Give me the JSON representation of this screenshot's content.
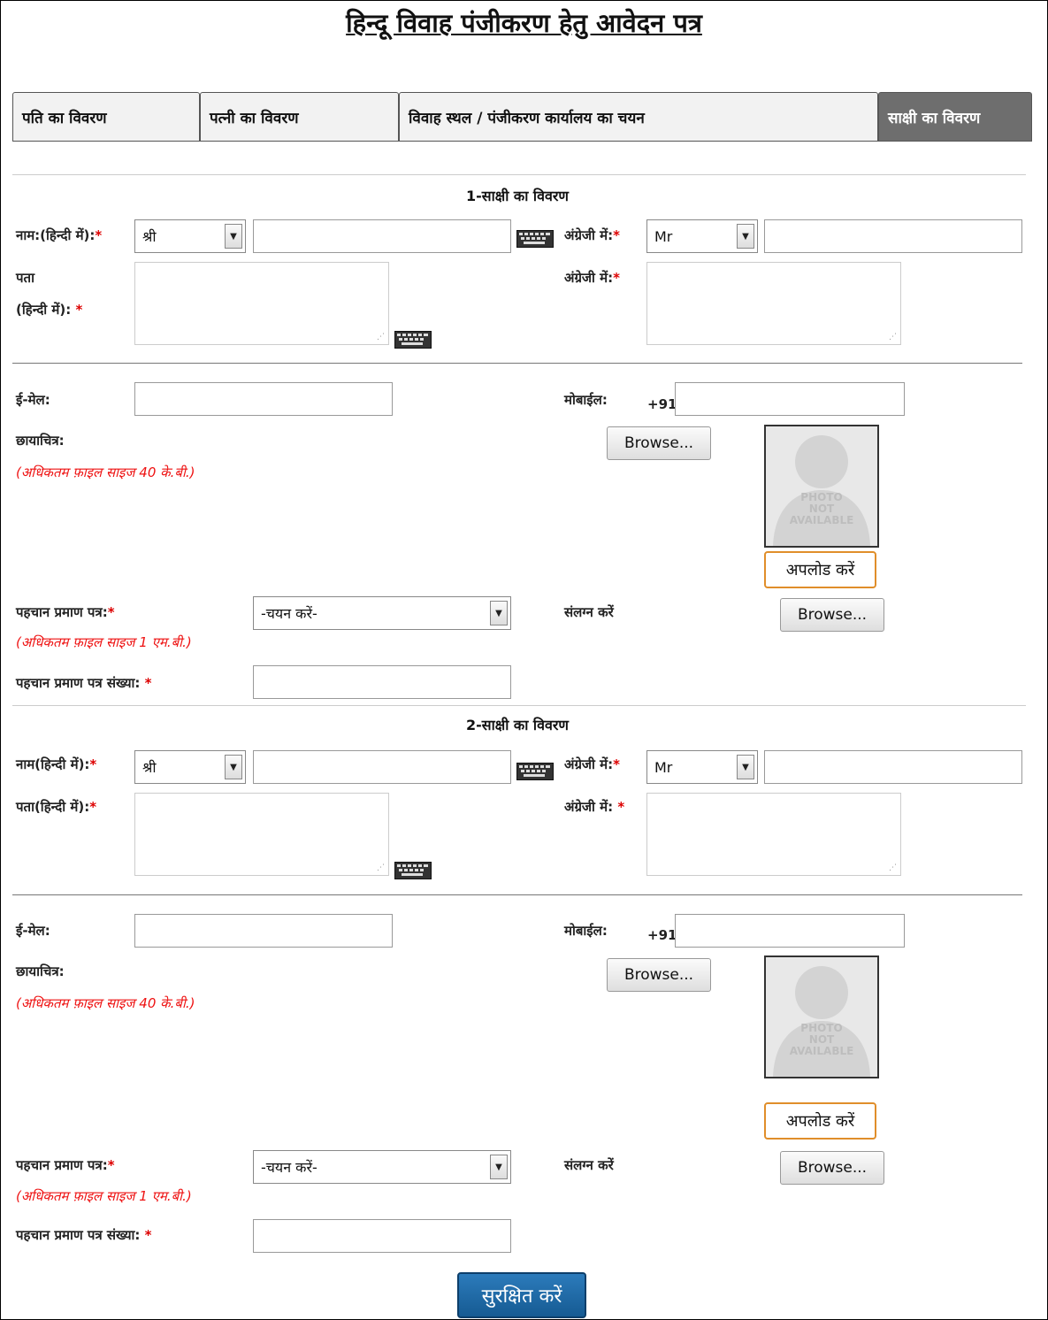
{
  "page": {
    "title": "हिन्दू विवाह पंजीकरण हेतु आवेदन पत्र"
  },
  "tabs": [
    {
      "label": "पति का विवरण",
      "active": false
    },
    {
      "label": "पत्नी का विवरण",
      "active": false
    },
    {
      "label": "विवाह स्थल / पंजीकरण कार्यालय का चयन",
      "active": false
    },
    {
      "label": "साक्षी का विवरण",
      "active": true
    }
  ],
  "witness1": {
    "heading": "1-साक्षी का विवरण",
    "name_label": "नाम:(हिन्दी में):",
    "salutation_hi": "श्री",
    "english_label": "अंग्रेजी में:",
    "salutation_en": "Mr",
    "address_label_line1": "पता",
    "address_label_line2": "(हिन्दी में):",
    "address_english_label": "अंग्रेजी में:",
    "email_label": "ई-मेल:",
    "mobile_label": "मोबाईल:",
    "mobile_prefix": "+91",
    "photo_label": "छायाचित्र:",
    "photo_note": "(अधिकतम फ़ाइल साइज 40 के.बी.)",
    "browse_label": "Browse...",
    "photo_placeholder": [
      "PHOTO",
      "NOT",
      "AVAILABLE"
    ],
    "upload_label": "अपलोड करें",
    "id_proof_label": "पहचान प्रमाण पत्र:",
    "id_proof_select": "-चयन करें-",
    "id_note": "(अधिकतम फ़ाइल साइज 1 एम.बी.)",
    "attach_label": "संलग्न करें",
    "attach_browse": "Browse...",
    "id_number_label": "पहचान प्रमाण पत्र संख्या:"
  },
  "witness2": {
    "heading": "2-साक्षी का विवरण",
    "name_label": "नाम(हिन्दी में):",
    "salutation_hi": "श्री",
    "english_label": "अंग्रेजी में:",
    "salutation_en": "Mr",
    "address_label": "पता(हिन्दी में):",
    "address_english_label": "अंग्रेजी में: ",
    "email_label": "ई-मेल:",
    "mobile_label": "मोबाईल:",
    "mobile_prefix": "+91",
    "photo_label": "छायाचित्र:",
    "photo_note": "(अधिकतम फ़ाइल साइज 40 के.बी.)",
    "browse_label": "Browse...",
    "photo_placeholder": [
      "PHOTO",
      "NOT",
      "AVAILABLE"
    ],
    "upload_label": "अपलोड करें",
    "id_proof_label": "पहचान प्रमाण पत्र:",
    "id_proof_select": "-चयन करें-",
    "id_note": "(अधिकतम फ़ाइल साइज 1 एम.बी.)",
    "attach_label": "संलग्न करें",
    "attach_browse": "Browse...",
    "id_number_label": "पहचान प्रमाण पत्र संख्या:"
  },
  "required_marker": "*",
  "save_label": "सुरक्षित करें"
}
